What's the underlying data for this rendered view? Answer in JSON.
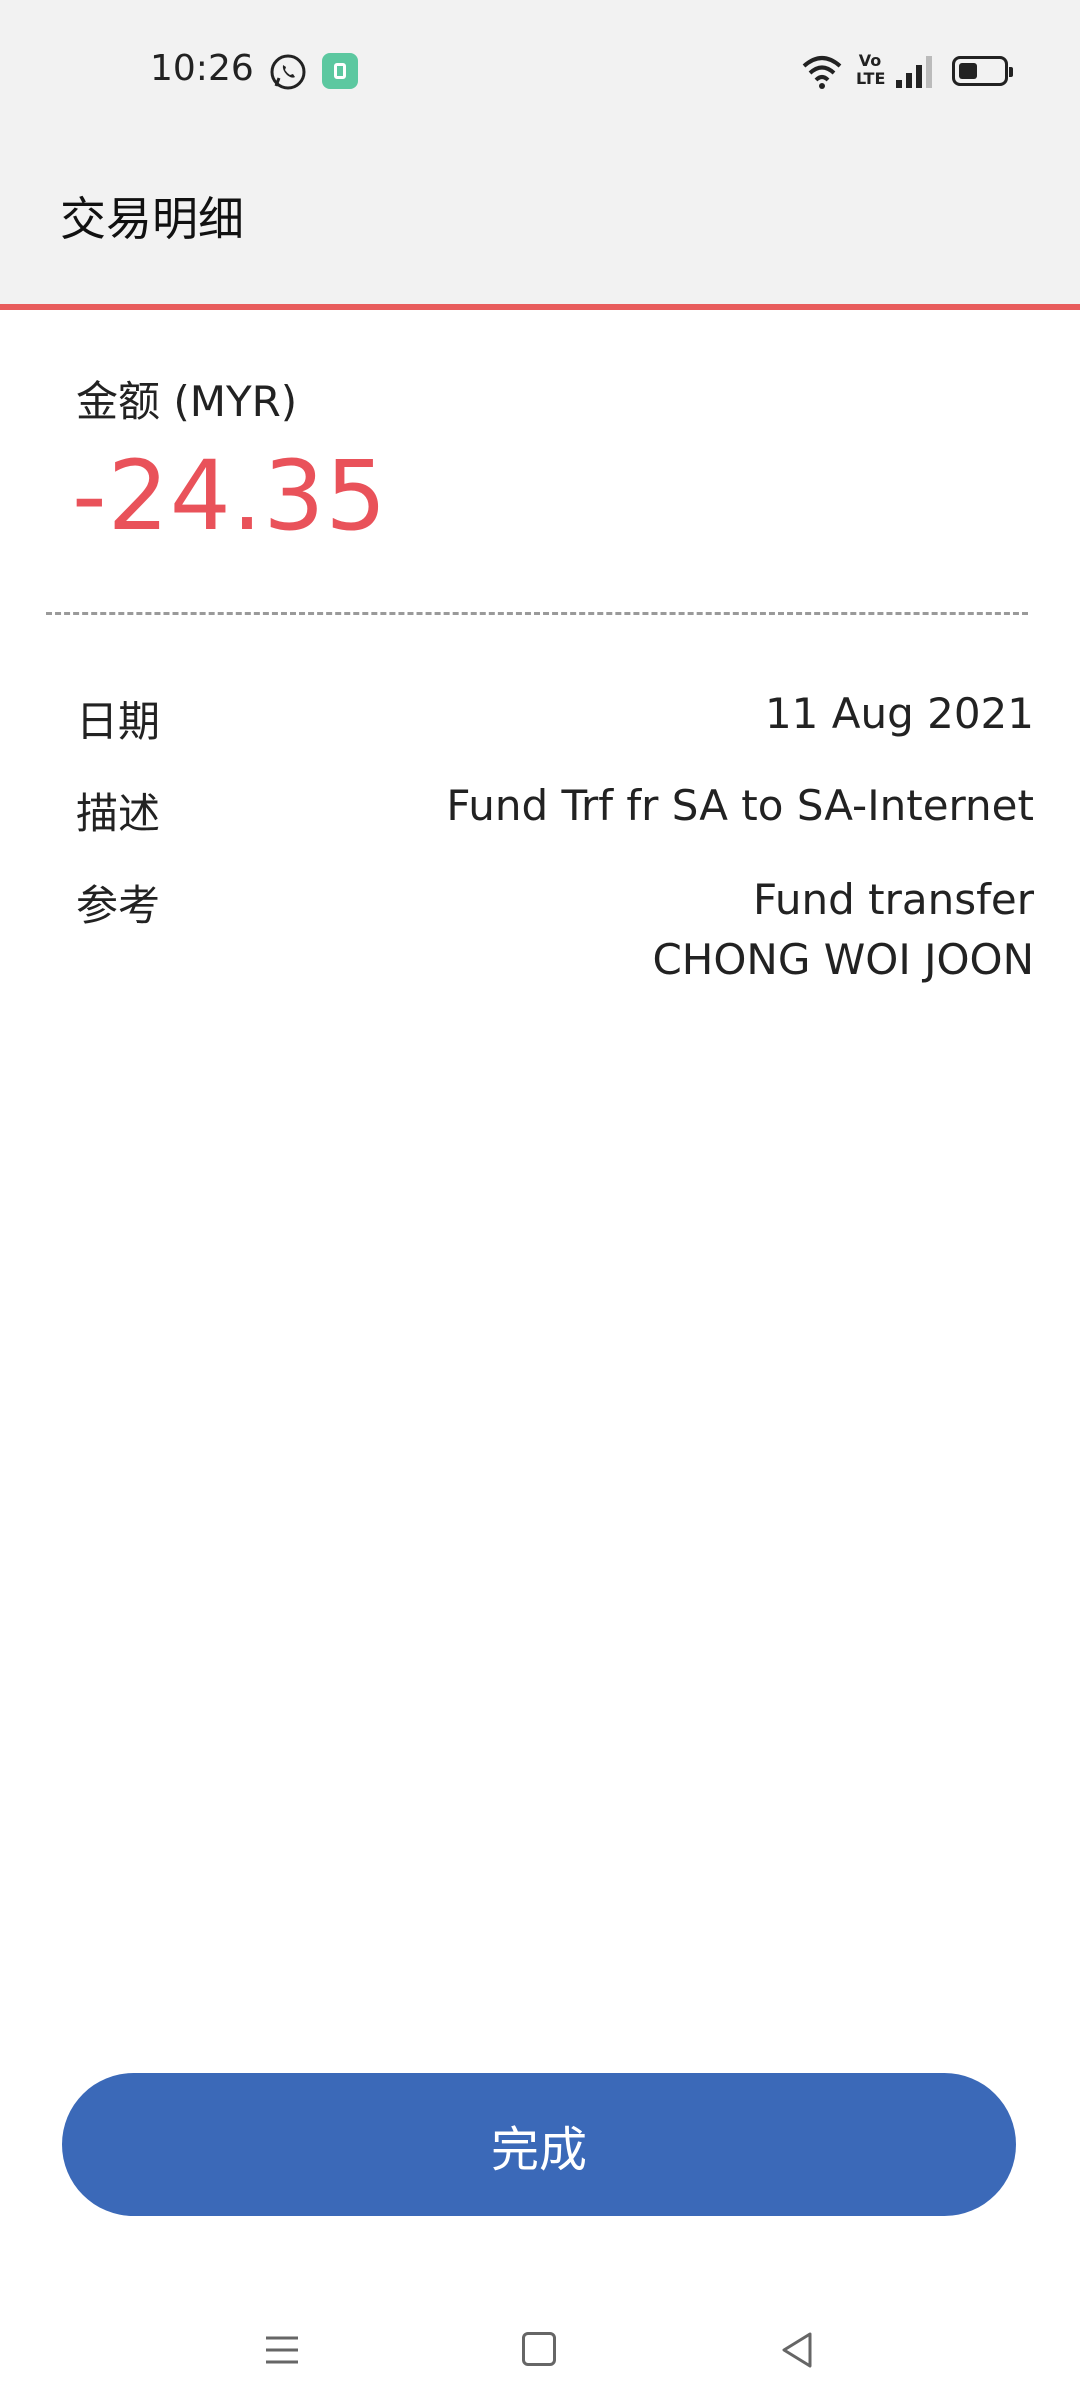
{
  "status_bar": {
    "time": "10:26",
    "volte_text": "Vo LTE",
    "icons": [
      "whatsapp-icon",
      "app-notification-icon",
      "wifi-icon",
      "volte-icon",
      "signal-icon",
      "battery-icon"
    ]
  },
  "header": {
    "title": "交易明细"
  },
  "amount": {
    "label": "金额 (MYR)",
    "value": "-24.35",
    "color": "#e9525a"
  },
  "details": [
    {
      "label": "日期",
      "value": "11 Aug 2021"
    },
    {
      "label": "描述",
      "value": "Fund Trf fr SA to SA-Internet"
    },
    {
      "label": "参考",
      "value_line1": "Fund transfer",
      "value_line2": "CHONG WOI JOON"
    }
  ],
  "footer": {
    "done_label": "完成",
    "button_color": "#3b69b8"
  },
  "nav_bar": {
    "icons": [
      "menu-icon",
      "home-icon",
      "back-icon"
    ]
  },
  "colors": {
    "accent_red": "#e85c5c",
    "header_bg": "#f2f2f2"
  }
}
